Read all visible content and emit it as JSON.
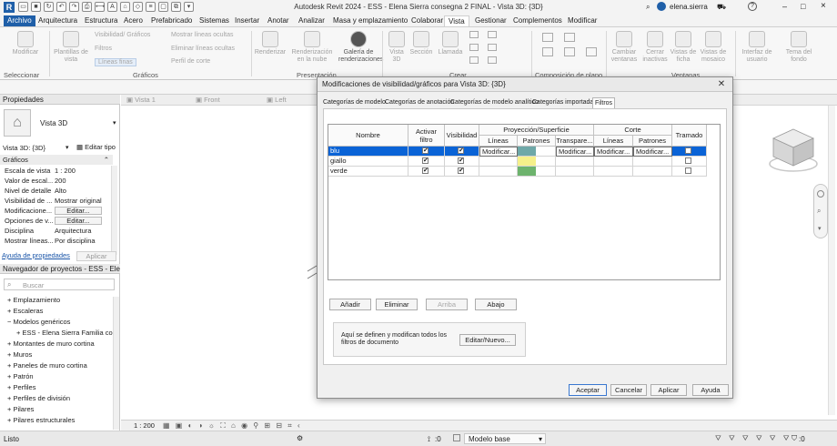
{
  "app": {
    "window_title": "Autodesk Revit 2024 - ESS - Elena Sierra consegna 2 FINAL - Vista 3D: {3D}",
    "user": "elena.sierra",
    "logo_letter": "R"
  },
  "ribbon_tabs": [
    "Archivo",
    "Arquitectura",
    "Estructura",
    "Acero",
    "Prefabricado",
    "Sistemas",
    "Insertar",
    "Anotar",
    "Analizar",
    "Masa y emplazamiento",
    "Colaborar",
    "Vista",
    "Gestionar",
    "Complementos",
    "Modificar"
  ],
  "ribbon": {
    "modify_label": "Modificar",
    "select_label": "Seleccionar",
    "graphics": {
      "plantillas": "Plantillas de vista",
      "items": [
        "Visibilidad/ Gráficos",
        "Filtros",
        "Líneas finas",
        "Mostrar líneas ocultas",
        "Eliminar líneas ocultas",
        "Perfil de corte"
      ],
      "label": "Gráficos"
    },
    "presentation": {
      "items": [
        "Renderizar",
        "Renderización en la nube",
        "Galería de renderizaciones"
      ],
      "label": "Presentación"
    },
    "create": {
      "items": [
        "Vista 3D",
        "Sección",
        "Llamada"
      ],
      "label": "Crear"
    },
    "sheet": {
      "label": "Composición de plano"
    },
    "windows": {
      "items": [
        "Cambiar ventanas",
        "Cerrar inactivas",
        "Vistas de ficha",
        "Vistas de mosaico",
        "Interfaz de usuario"
      ],
      "label": "Ventanas"
    },
    "theme": "Tema del fondo"
  },
  "properties": {
    "header": "Propiedades",
    "type_name": "Vista 3D",
    "selector": "Vista 3D: {3D}",
    "edit_type": "Editar tipo",
    "section": "Gráficos",
    "rows": [
      {
        "k": "Escala de vista",
        "v": "1 : 200"
      },
      {
        "k": "Valor de escal...",
        "v": "200"
      },
      {
        "k": "Nivel de detalle",
        "v": "Alto"
      },
      {
        "k": "Visibilidad de ...",
        "v": "Mostrar original"
      },
      {
        "k": "Modificacione...",
        "v": "Editar..."
      },
      {
        "k": "Opciones de v...",
        "v": "Editar..."
      },
      {
        "k": "Disciplina",
        "v": "Arquitectura"
      },
      {
        "k": "Mostrar líneas...",
        "v": "Por disciplina"
      }
    ],
    "help_link": "Ayuda de propiedades",
    "apply": "Aplicar"
  },
  "navigator": {
    "header": "Navegador de proyectos - ESS - Elena...",
    "search_placeholder": "Buscar",
    "items": [
      {
        "label": "Emplazamiento",
        "prefix": "+"
      },
      {
        "label": "Escaleras",
        "prefix": "+"
      },
      {
        "label": "Modelos genéricos",
        "prefix": "−"
      },
      {
        "label": "ESS - Elena Sierra Familia co",
        "prefix": "+"
      },
      {
        "label": "Montantes de muro cortina",
        "prefix": "+"
      },
      {
        "label": "Muros",
        "prefix": "+"
      },
      {
        "label": "Paneles de muro cortina",
        "prefix": "+"
      },
      {
        "label": "Patrón",
        "prefix": "+"
      },
      {
        "label": "Perfiles",
        "prefix": "+"
      },
      {
        "label": "Perfiles de división",
        "prefix": "+"
      },
      {
        "label": "Pilares",
        "prefix": "+"
      },
      {
        "label": "Pilares estructurales",
        "prefix": "+"
      }
    ]
  },
  "view_tabs": [
    "Vista 1",
    "Front",
    "Left"
  ],
  "view_bar": {
    "scale": "1 : 200"
  },
  "status": {
    "text": "Listo",
    "zero_a": ":0",
    "model": "Modelo base",
    "zero_b": ":0"
  },
  "dialog": {
    "title": "Modificaciones de visibilidad/gráficos para Vista 3D: {3D}",
    "tabs": [
      "Categorías de modelo",
      "Categorías de anotación",
      "Categorías de modelo analítico",
      "Categorías importadas",
      "Filtros"
    ],
    "active_tab": "Filtros",
    "table": {
      "headers": {
        "nombre": "Nombre",
        "activar": "Activar filtro",
        "visibilidad": "Visibilidad",
        "proyeccion": "Proyección/Superficie",
        "corte": "Corte",
        "tramado": "Tramado",
        "lineas": "Líneas",
        "patrones": "Patrones",
        "transparencia": "Transpare...",
        "lineas_c": "Líneas",
        "patrones_c": "Patrones"
      },
      "rows": [
        {
          "name": "blu",
          "lineas": "Modificar...",
          "transp": "Modificar...",
          "lineas_c": "Modificar...",
          "patrones_c": "Modificar...",
          "swatch": "#6ea8a8",
          "active": true,
          "visible": true,
          "tramado": false,
          "selected": true
        },
        {
          "name": "giallo",
          "lineas": "",
          "transp": "",
          "lineas_c": "",
          "patrones_c": "",
          "swatch": "#f5f08a",
          "active": true,
          "visible": true,
          "tramado": false,
          "selected": false
        },
        {
          "name": "verde",
          "lineas": "",
          "transp": "",
          "lineas_c": "",
          "patrones_c": "",
          "swatch": "#6db36d",
          "active": true,
          "visible": true,
          "tramado": false,
          "selected": false
        }
      ]
    },
    "buttons": {
      "add": "Añadir",
      "remove": "Eliminar",
      "up": "Arriba",
      "down": "Abajo",
      "edit_new": "Editar/Nuevo...",
      "ok": "Aceptar",
      "cancel": "Cancelar",
      "apply": "Aplicar",
      "help": "Ayuda"
    },
    "info_text": "Aquí se definen y modifican todos los filtros de documento",
    "colors": {
      "selection": "#0a63d6",
      "title_bg": "#e9e9e9"
    }
  },
  "colors": {
    "accent": "#1f5fa8"
  }
}
